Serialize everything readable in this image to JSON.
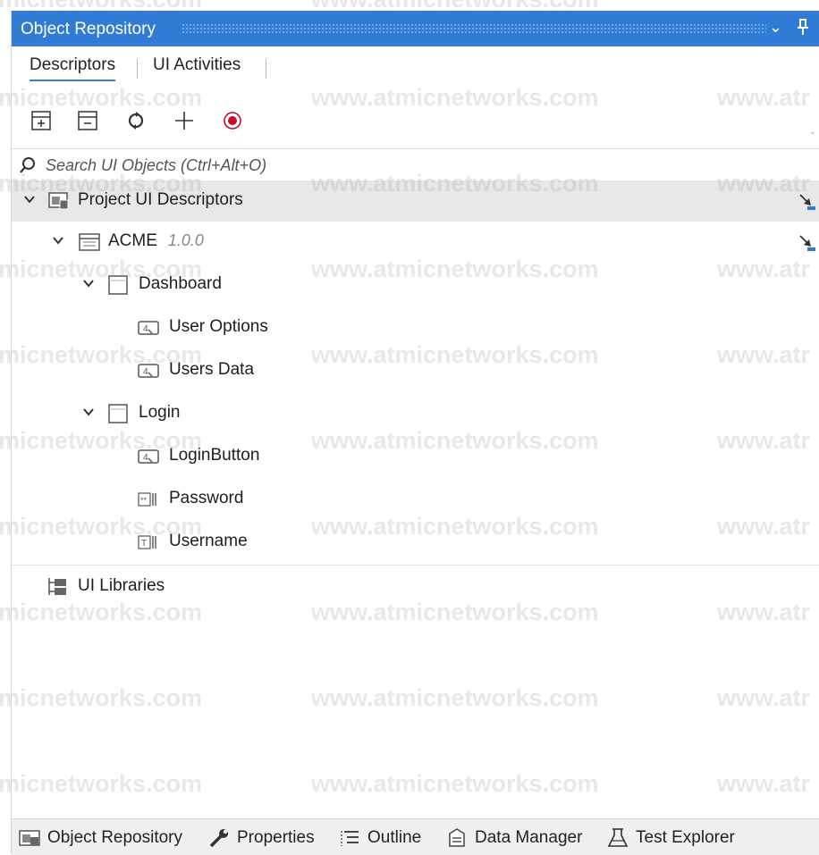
{
  "panel": {
    "title": "Object Repository"
  },
  "tabs": [
    {
      "label": "Descriptors",
      "active": true
    },
    {
      "label": "UI Activities",
      "active": false
    }
  ],
  "toolbar": {
    "icons": [
      "expand-all-icon",
      "collapse-all-icon",
      "refresh-icon",
      "add-icon",
      "record-icon"
    ]
  },
  "search": {
    "placeholder": "Search UI Objects (Ctrl+Alt+O)"
  },
  "tree": {
    "root_label": "Project UI Descriptors",
    "app_label": "ACME",
    "app_version": "1.0.0",
    "screens": [
      {
        "label": "Dashboard",
        "elements": [
          "User Options",
          "Users Data"
        ]
      },
      {
        "label": "Login",
        "elements": [
          "LoginButton",
          "Password",
          "Username"
        ]
      }
    ],
    "libraries_label": "UI Libraries"
  },
  "bottom_tabs": [
    {
      "label": "Object Repository",
      "icon": "object-repository-icon"
    },
    {
      "label": "Properties",
      "icon": "wrench-icon"
    },
    {
      "label": "Outline",
      "icon": "outline-icon"
    },
    {
      "label": "Data Manager",
      "icon": "data-manager-icon"
    },
    {
      "label": "Test Explorer",
      "icon": "flask-icon"
    }
  ],
  "watermark": {
    "text_full": "www.atmicnetworks.com",
    "text_left": "micnetworks.com",
    "text_right": "www.atr"
  },
  "colors": {
    "titlebar": "#2f7bd6",
    "record": "#c0102a",
    "highlight_row": "#e8e8e8"
  }
}
